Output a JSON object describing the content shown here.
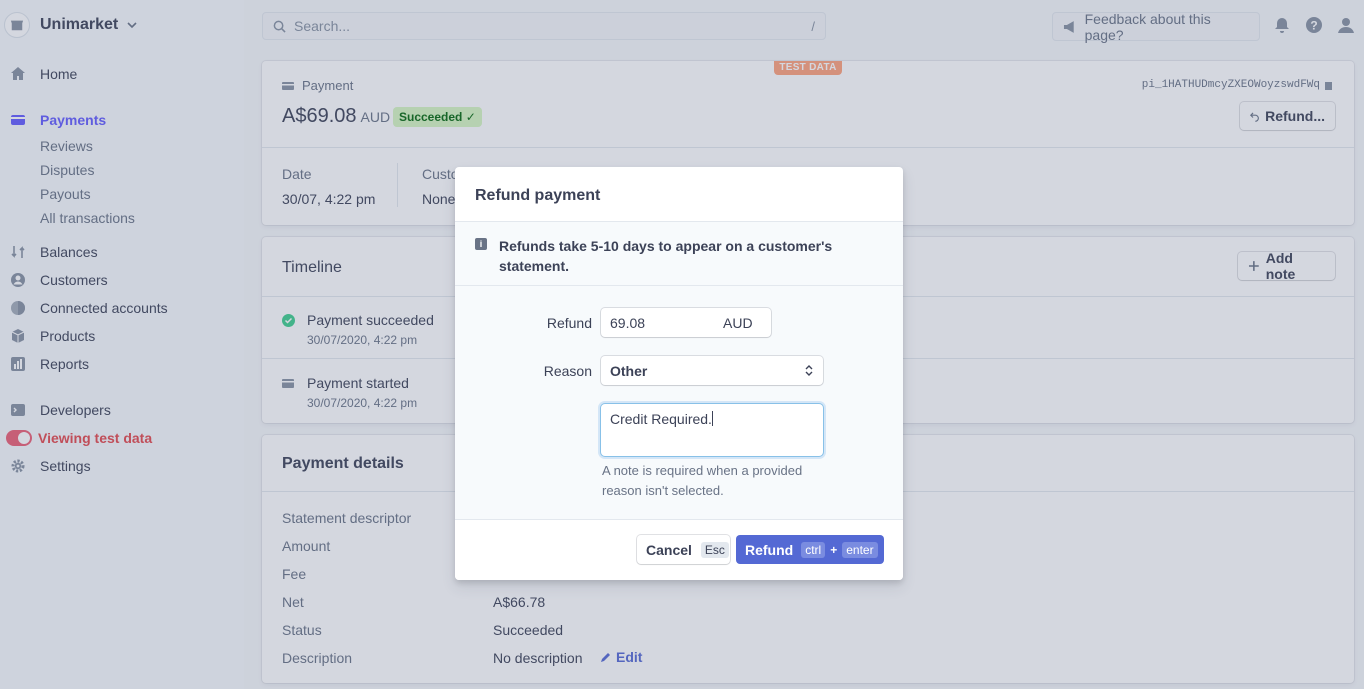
{
  "brand": {
    "name": "Unimarket"
  },
  "nav": {
    "home": "Home",
    "payments": "Payments",
    "reviews": "Reviews",
    "disputes": "Disputes",
    "payouts": "Payouts",
    "all_transactions": "All transactions",
    "balances": "Balances",
    "customers": "Customers",
    "connected_accounts": "Connected accounts",
    "products": "Products",
    "reports": "Reports",
    "developers": "Developers",
    "test_data": "Viewing test data",
    "settings": "Settings"
  },
  "topbar": {
    "search_placeholder": "Search...",
    "search_shortcut": "/",
    "feedback": "Feedback about this page?"
  },
  "payment": {
    "test_badge": "TEST DATA",
    "label": "Payment",
    "amount": "A$69.08",
    "currency": "AUD",
    "status": "Succeeded ✓",
    "id": "pi_1HATHUDmcyZXEOWoyzswdFWq",
    "refund_button": "Refund...",
    "date_label": "Date",
    "date_value": "30/07, 4:22 pm",
    "customer_label": "Custo",
    "customer_value": "None"
  },
  "timeline": {
    "title": "Timeline",
    "add_note": "Add note",
    "events": [
      {
        "title": "Payment succeeded",
        "date": "30/07/2020, 4:22 pm"
      },
      {
        "title": "Payment started",
        "date": "30/07/2020, 4:22 pm"
      }
    ]
  },
  "details": {
    "title": "Payment details",
    "rows": [
      {
        "label": "Statement descriptor",
        "value": ""
      },
      {
        "label": "Amount",
        "value": ""
      },
      {
        "label": "Fee",
        "value": ""
      },
      {
        "label": "Net",
        "value": "A$66.78"
      },
      {
        "label": "Status",
        "value": "Succeeded"
      },
      {
        "label": "Description",
        "value": "No description"
      }
    ],
    "edit": "Edit"
  },
  "modal": {
    "title": "Refund payment",
    "info": "Refunds take 5-10 days to appear on a customer's statement.",
    "refund_label": "Refund",
    "refund_amount": "69.08",
    "refund_currency": "AUD",
    "reason_label": "Reason",
    "reason_value": "Other",
    "note_value": "Credit Required.",
    "hint": "A note is required when a provided reason isn't selected.",
    "cancel": "Cancel",
    "cancel_key": "Esc",
    "submit": "Refund",
    "submit_key1": "ctrl",
    "submit_plus": "+",
    "submit_key2": "enter"
  },
  "colors": {
    "accent": "#635bff",
    "primary_button": "#5469d4",
    "success_bg": "#d7f7c2",
    "test_badge": "#ffa27b",
    "test_toggle": "#ed5f74"
  }
}
